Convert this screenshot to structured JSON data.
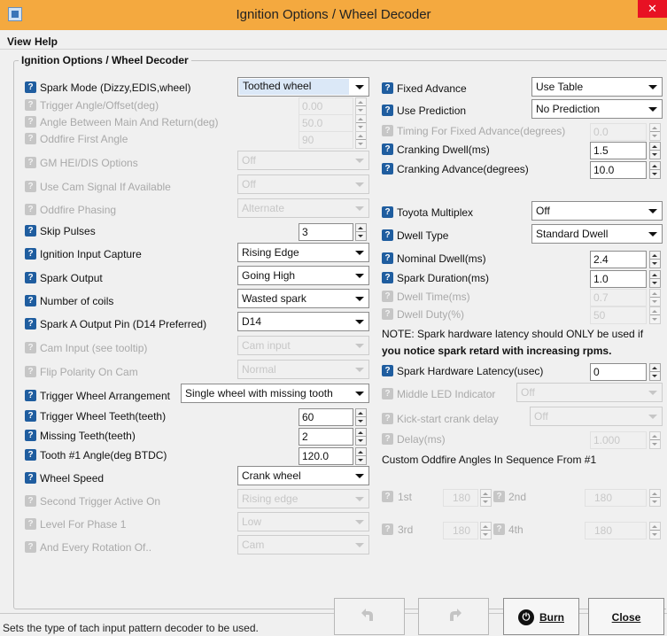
{
  "window": {
    "title": "Ignition Options / Wheel Decoder",
    "close_glyph": "✕",
    "app_icon": "app-window-icon"
  },
  "menu": {
    "view": "View",
    "help": "Help"
  },
  "group": {
    "title": "Ignition Options / Wheel Decoder"
  },
  "help_glyph": "?",
  "left": {
    "spark_mode": {
      "label": "Spark Mode (Dizzy,EDIS,wheel)",
      "value": "Toothed wheel"
    },
    "trigger_angle": {
      "label": "Trigger Angle/Offset(deg)",
      "value": "0.00"
    },
    "angle_main_return": {
      "label": "Angle Between Main And Return(deg)",
      "value": "50.0"
    },
    "oddfire_first": {
      "label": "Oddfire First Angle",
      "value": "90"
    },
    "gm_hei": {
      "label": "GM HEI/DIS Options",
      "value": "Off"
    },
    "use_cam": {
      "label": "Use Cam Signal If Available",
      "value": "Off"
    },
    "oddfire_phasing": {
      "label": "Oddfire Phasing",
      "value": "Alternate"
    },
    "skip_pulses": {
      "label": "Skip Pulses",
      "value": "3"
    },
    "ign_input_capture": {
      "label": "Ignition Input Capture",
      "value": "Rising Edge"
    },
    "spark_output": {
      "label": "Spark Output",
      "value": "Going High"
    },
    "num_coils": {
      "label": "Number of coils",
      "value": "Wasted spark"
    },
    "spark_a_pin": {
      "label": "Spark A Output Pin (D14 Preferred)",
      "value": "D14"
    },
    "cam_input": {
      "label": "Cam Input (see tooltip)",
      "value": "Cam input"
    },
    "flip_polarity": {
      "label": "Flip Polarity On Cam",
      "value": "Normal"
    },
    "trigger_arrangement": {
      "label": "Trigger Wheel Arrangement",
      "value": "Single wheel with missing tooth"
    },
    "trigger_teeth": {
      "label": "Trigger Wheel Teeth(teeth)",
      "value": "60"
    },
    "missing_teeth": {
      "label": "Missing Teeth(teeth)",
      "value": "2"
    },
    "tooth1_angle": {
      "label": "Tooth #1 Angle(deg BTDC)",
      "value": "120.0"
    },
    "wheel_speed": {
      "label": "Wheel Speed",
      "value": "Crank wheel"
    },
    "second_trigger": {
      "label": "Second Trigger Active On",
      "value": "Rising edge"
    },
    "level_phase1": {
      "label": "Level For Phase 1",
      "value": "Low"
    },
    "every_rotation": {
      "label": "And Every Rotation Of..",
      "value": "Cam"
    }
  },
  "right": {
    "fixed_advance": {
      "label": "Fixed Advance",
      "value": "Use Table"
    },
    "use_prediction": {
      "label": "Use Prediction",
      "value": "No Prediction"
    },
    "timing_fixed": {
      "label": "Timing For Fixed Advance(degrees)",
      "value": "0.0"
    },
    "cranking_dwell": {
      "label": "Cranking Dwell(ms)",
      "value": "1.5"
    },
    "cranking_advance": {
      "label": "Cranking Advance(degrees)",
      "value": "10.0"
    },
    "toyota_multiplex": {
      "label": "Toyota Multiplex",
      "value": "Off"
    },
    "dwell_type": {
      "label": "Dwell Type",
      "value": "Standard Dwell"
    },
    "nominal_dwell": {
      "label": "Nominal Dwell(ms)",
      "value": "2.4"
    },
    "spark_duration": {
      "label": "Spark Duration(ms)",
      "value": "1.0"
    },
    "dwell_time": {
      "label": "Dwell Time(ms)",
      "value": "0.7"
    },
    "dwell_duty": {
      "label": "Dwell Duty(%)",
      "value": "50"
    },
    "note_line1": "NOTE: Spark hardware latency should ONLY be used if",
    "note_line2": "you notice spark retard with increasing rpms.",
    "spark_latency": {
      "label": "Spark Hardware Latency(usec)",
      "value": "0"
    },
    "middle_led": {
      "label": "Middle LED Indicator",
      "value": "Off"
    },
    "kick_start": {
      "label": "Kick-start crank delay",
      "value": "Off"
    },
    "delay": {
      "label": "Delay(ms)",
      "value": "1.000"
    },
    "oddfire_title": "Custom Oddfire Angles In Sequence From #1",
    "angle_1st": {
      "label": "1st",
      "value": "180"
    },
    "angle_2nd": {
      "label": "2nd",
      "value": "180"
    },
    "angle_3rd": {
      "label": "3rd",
      "value": "180"
    },
    "angle_4th": {
      "label": "4th",
      "value": "180"
    }
  },
  "status": "Sets the type of tach input pattern decoder to be used.",
  "buttons": {
    "burn": "Burn",
    "close": "Close",
    "burn_icon": "power-icon",
    "undo_icon": "undo-icon",
    "redo_icon": "redo-icon"
  }
}
